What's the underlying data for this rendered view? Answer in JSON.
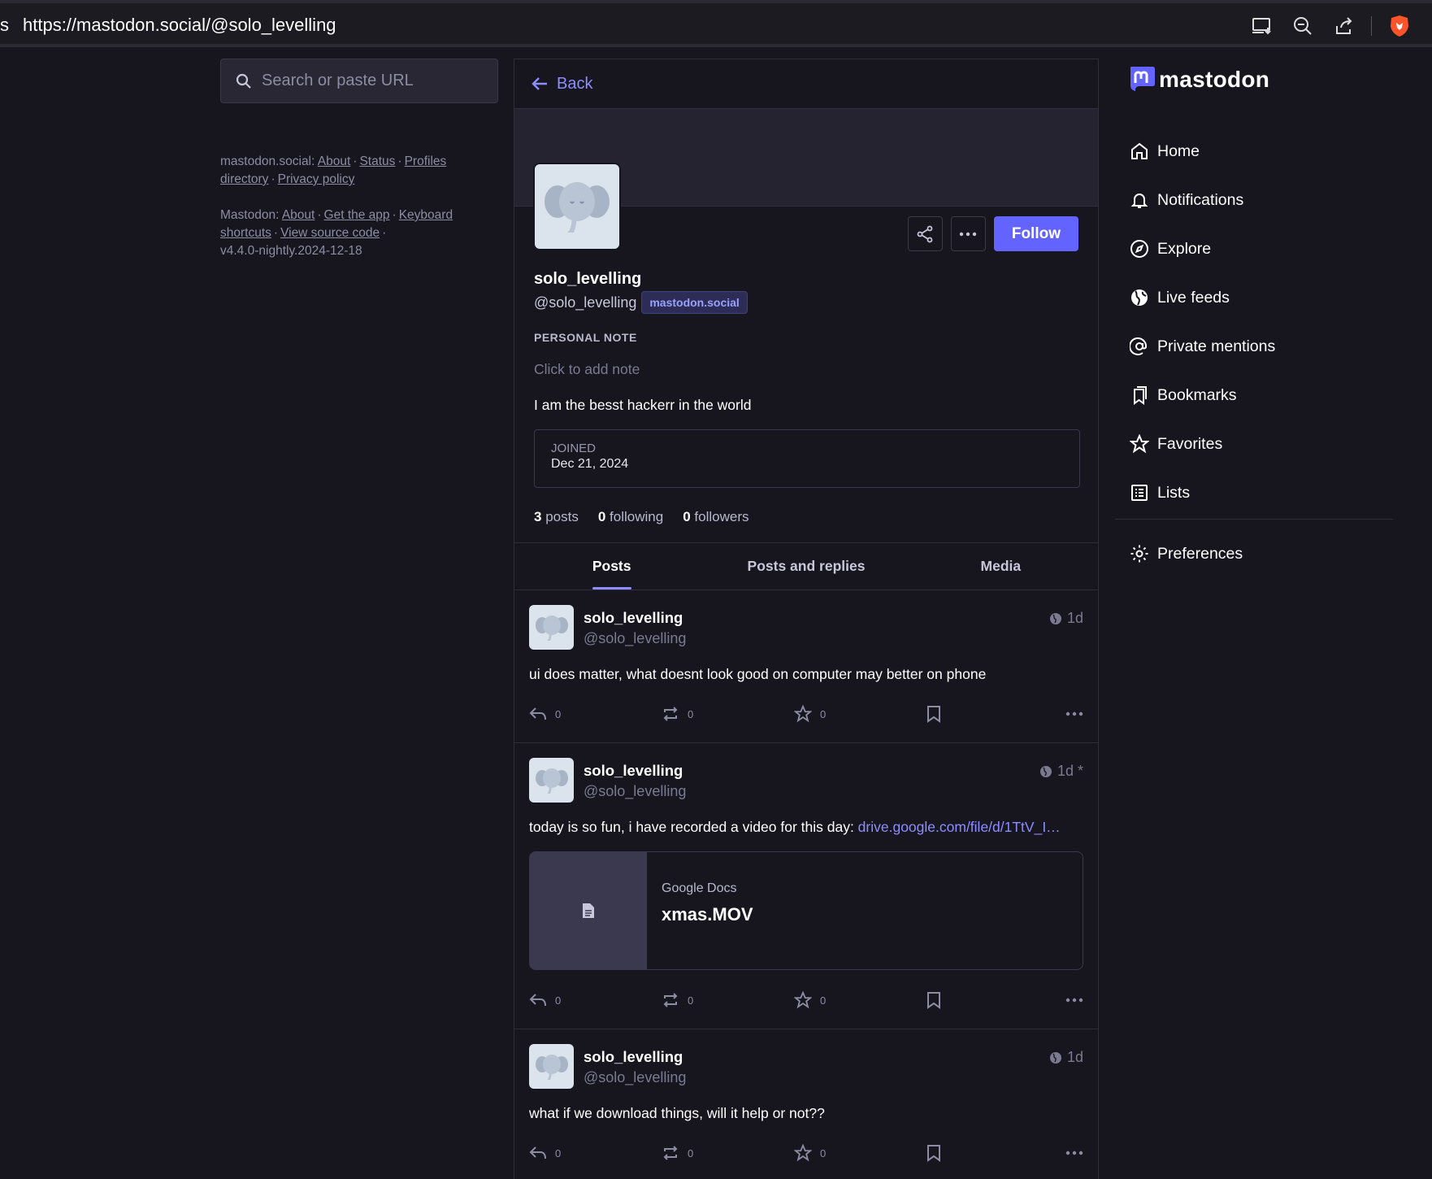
{
  "browser": {
    "url_edge": "s",
    "url": "https://mastodon.social/@solo_levelling"
  },
  "search": {
    "placeholder": "Search or paste URL"
  },
  "footer": {
    "site": "mastodon.social",
    "site_links": [
      "About",
      "Status",
      "Profiles directory",
      "Privacy policy"
    ],
    "app": "Mastodon",
    "app_links": [
      "About",
      "Get the app",
      "Keyboard shortcuts",
      "View source code"
    ],
    "version": "v4.4.0-nightly.2024-12-18"
  },
  "header": {
    "back_label": "Back"
  },
  "profile": {
    "display_name": "solo_levelling",
    "handle": "@solo_levelling",
    "domain": "mastodon.social",
    "follow_label": "Follow",
    "note_label": "PERSONAL NOTE",
    "note_placeholder": "Click to add note",
    "bio": "I am the besst hackerr in the world",
    "joined_label": "JOINED",
    "joined_date": "Dec 21, 2024",
    "stats": [
      {
        "count": "3",
        "label": "posts"
      },
      {
        "count": "0",
        "label": "following"
      },
      {
        "count": "0",
        "label": "followers"
      }
    ]
  },
  "tabs": [
    "Posts",
    "Posts and replies",
    "Media"
  ],
  "posts": [
    {
      "name": "solo_levelling",
      "handle": "@solo_levelling",
      "time": "1d",
      "text": "ui does matter, what doesnt look good on computer may better on phone",
      "replies": "0",
      "boosts": "0",
      "favs": "0"
    },
    {
      "name": "solo_levelling",
      "handle": "@solo_levelling",
      "time": "1d *",
      "text": "today is so fun, i have recorded a video for this day: ",
      "link": "drive.google.com/file/d/1TtV_I…",
      "card_provider": "Google Docs",
      "card_title": "xmas.MOV",
      "replies": "0",
      "boosts": "0",
      "favs": "0"
    },
    {
      "name": "solo_levelling",
      "handle": "@solo_levelling",
      "time": "1d",
      "text": "what if we download things, will it help or not??",
      "replies": "0",
      "boosts": "0",
      "favs": "0"
    }
  ],
  "logo_text": "mastodon",
  "nav": [
    "Home",
    "Notifications",
    "Explore",
    "Live feeds",
    "Private mentions",
    "Bookmarks",
    "Favorites",
    "Lists"
  ],
  "nav_pref": "Preferences",
  "colors": {
    "accent": "#6364ff",
    "link": "#8c8dff",
    "background": "#17161f"
  }
}
